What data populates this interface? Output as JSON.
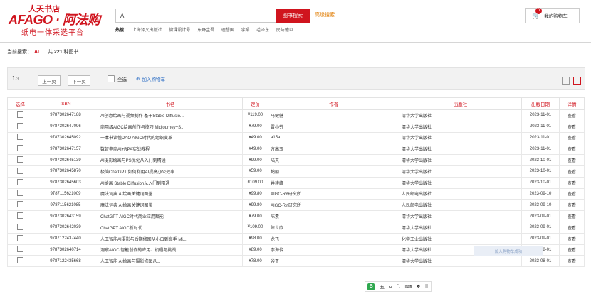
{
  "logo": {
    "top": "人天书店",
    "main": "AFAGO · 阿法购",
    "sub": "纸电一体采选平台"
  },
  "search": {
    "value": "AI",
    "button": "图书搜索",
    "advanced": "高级搜索"
  },
  "hot": {
    "label": "热搜：",
    "items": [
      "上海译文出版社",
      "微课设计号",
      "东野圭吾",
      "理想国",
      "李娟",
      "毛泽东",
      "民与他以"
    ]
  },
  "cart": {
    "label": "我的购物车",
    "count": "0"
  },
  "crumb": {
    "label": "当前搜索：",
    "keyword": "AI",
    "count_prefix": "共",
    "count": "221",
    "count_suffix": "种图书"
  },
  "toolbar": {
    "page_current": "1",
    "page_total": "/3",
    "prev": "上一页",
    "next": "下一页",
    "select_all": "全选",
    "add_cart": "加入购物车"
  },
  "colors": {
    "brand": "#d0141e",
    "link": "#2a6cc4"
  },
  "table": {
    "headers": [
      "选择",
      "ISBN",
      "书名",
      "定价",
      "作者",
      "出版社",
      "出版日期",
      "详情"
    ],
    "rows": [
      {
        "isbn": "9787302647188",
        "title": "AI创意绘画与视频制作 基于Stable Diffusio...",
        "price": "¥119.00",
        "author": "马健健",
        "publisher": "清华大学出版社",
        "date": "2023-11-01",
        "detail": "查看"
      },
      {
        "isbn": "9787302647096",
        "title": "商用级AIGC绘画创作与技巧 Midjourney+S...",
        "price": "¥79.00",
        "author": "雷小芬",
        "publisher": "清华大学出版社",
        "date": "2023-11-01",
        "detail": "查看"
      },
      {
        "isbn": "9787302645092",
        "title": "一本书读懂DAO AIGC时代的组织变革",
        "price": "¥49.00",
        "author": "a15a",
        "publisher": "清华大学出版社",
        "date": "2023-11-01",
        "detail": "查看"
      },
      {
        "isbn": "9787302647157",
        "title": "数智电商AI+RPA实战教程",
        "price": "¥49.00",
        "author": "方高玉",
        "publisher": "清华大学出版社",
        "date": "2023-11-01",
        "detail": "查看"
      },
      {
        "isbn": "9787302645139",
        "title": "AI摄影绘画与PS优化从入门到精通",
        "price": "¥99.00",
        "author": "陆天",
        "publisher": "清华大学出版社",
        "date": "2023-10-01",
        "detail": "查看"
      },
      {
        "isbn": "9787302645870",
        "title": "极简ChatGPT 如何利用AI提高办公效率",
        "price": "¥59.00",
        "author": "鹤翮",
        "publisher": "清华大学出版社",
        "date": "2023-10-01",
        "detail": "查看"
      },
      {
        "isbn": "9787302645603",
        "title": "AI绘画 Stable Diffusion从入门到精通",
        "price": "¥109.00",
        "author": "井建峰",
        "publisher": "清华大学出版社",
        "date": "2023-10-01",
        "detail": "查看"
      },
      {
        "isbn": "9787115621009",
        "title": "魔法词典 AI绘画关键词图鉴",
        "price": "¥99.80",
        "author": "AIGC-RY研究所",
        "publisher": "人民邮电出版社",
        "date": "2023-09-10",
        "detail": "查看"
      },
      {
        "isbn": "9787115621085",
        "title": "魔法词典 AI绘画关键词图鉴",
        "price": "¥99.80",
        "author": "AIGC-RY研究所",
        "publisher": "人民邮电出版社",
        "date": "2023-09-10",
        "detail": "查看"
      },
      {
        "isbn": "9787302643159",
        "title": "ChatGPT AIGC时代商业应用赋能",
        "price": "¥79.00",
        "author": "陈素",
        "publisher": "清华大学出版社",
        "date": "2023-09-01",
        "detail": "查看"
      },
      {
        "isbn": "9787302642039",
        "title": "ChatGPT AIGC新时代",
        "price": "¥109.00",
        "author": "陈世欣",
        "publisher": "清华大学出版社",
        "date": "2023-09-01",
        "detail": "查看"
      },
      {
        "isbn": "9787122437440",
        "title": "人工智能AI摄影与后期修图从小白到高手 Mi...",
        "price": "¥98.00",
        "author": "龙飞",
        "publisher": "化学工业出版社",
        "date": "2023-09-01",
        "detail": "查看"
      },
      {
        "isbn": "9787302640714",
        "title": "洞察AIGC 智能创作的应用、机遇与挑战",
        "price": "¥89.00",
        "author": "李海俊",
        "publisher": "清华大学出版社",
        "date": "2023-08-01",
        "detail": "查看"
      },
      {
        "isbn": "9787122435668",
        "title": "人工智能 AI绘画与摄影修图从...",
        "price": "¥78.00",
        "author": "谷哥",
        "publisher": "清华大学出版社",
        "date": "2023-08-01",
        "detail": "查看"
      }
    ]
  },
  "toast": "加入购物车成功",
  "ime": {
    "logo": "S",
    "items": [
      "五",
      "ᴗ",
      "°,",
      "⌨",
      "♣",
      "⠿"
    ]
  }
}
